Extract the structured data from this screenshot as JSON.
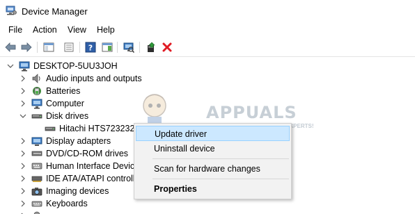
{
  "window": {
    "title": "Device Manager",
    "icon": "device-manager-icon"
  },
  "menu": [
    "File",
    "Action",
    "View",
    "Help"
  ],
  "toolbar": {
    "buttons": [
      "back-arrow-icon",
      "forward-arrow-icon",
      "show-hide-console-tree-icon",
      "properties-icon",
      "help-icon",
      "action-pane-icon",
      "scan-hardware-icon",
      "update-driver-icon",
      "uninstall-device-icon"
    ],
    "colors": {
      "back": "#3b7dd8",
      "uninstall": "#e01b24",
      "update": "#2f9a3a"
    }
  },
  "tree": {
    "root": "DESKTOP-5UU3JOH",
    "items": [
      {
        "label": "Audio inputs and outputs",
        "icon": "speaker-icon"
      },
      {
        "label": "Batteries",
        "icon": "battery-icon"
      },
      {
        "label": "Computer",
        "icon": "computer-icon"
      },
      {
        "label": "Disk drives",
        "icon": "disk-drive-icon",
        "expanded": true
      },
      {
        "label": "Hitachi HTS723232",
        "icon": "disk-drive-icon",
        "child": true
      },
      {
        "label": "Display adapters",
        "icon": "display-adapter-icon"
      },
      {
        "label": "DVD/CD-ROM drives",
        "icon": "dvd-drive-icon"
      },
      {
        "label": "Human Interface Devic",
        "icon": "hid-icon"
      },
      {
        "label": "IDE ATA/ATAPI controll",
        "icon": "ide-controller-icon"
      },
      {
        "label": "Imaging devices",
        "icon": "camera-icon"
      },
      {
        "label": "Keyboards",
        "icon": "keyboard-icon"
      }
    ]
  },
  "context_menu": {
    "items": [
      {
        "label": "Update driver",
        "highlighted": true
      },
      {
        "label": "Uninstall device"
      },
      {
        "label": "Scan for hardware changes"
      },
      {
        "label": "Properties",
        "bold": true
      }
    ]
  },
  "watermark": {
    "text": "APPUALS",
    "sub": "TECH HOW-TO'S FROM THE EXPERTS!"
  }
}
